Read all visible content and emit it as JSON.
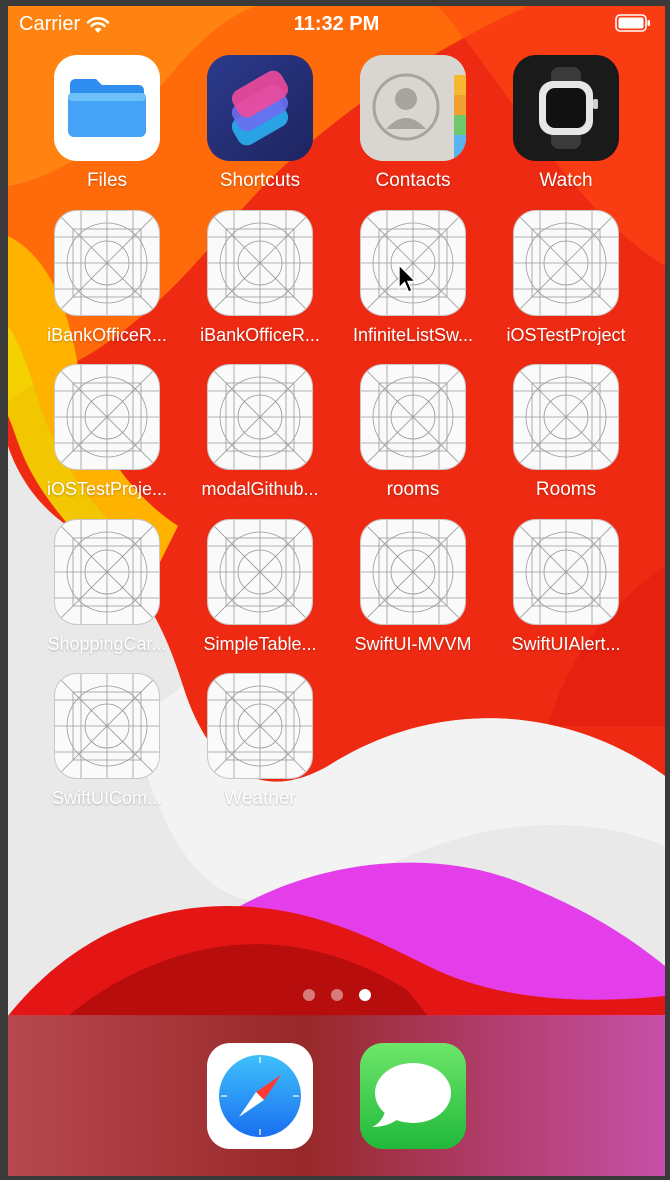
{
  "status_bar": {
    "carrier": "Carrier",
    "time": "11:32 PM",
    "wifi_icon": "wifi-icon",
    "battery_icon": "battery-icon"
  },
  "home_screen": {
    "apps": [
      {
        "label": "Files",
        "icon": "files-folder-icon"
      },
      {
        "label": "Shortcuts",
        "icon": "shortcuts-icon"
      },
      {
        "label": "Contacts",
        "icon": "contacts-icon"
      },
      {
        "label": "Watch",
        "icon": "watch-icon"
      },
      {
        "label": "iBankOfficeR...",
        "icon": "placeholder-app-icon"
      },
      {
        "label": "iBankOfficeR...",
        "icon": "placeholder-app-icon"
      },
      {
        "label": "InfiniteListSw...",
        "icon": "placeholder-app-icon"
      },
      {
        "label": "iOSTestProject",
        "icon": "placeholder-app-icon"
      },
      {
        "label": "iOSTestProje...",
        "icon": "placeholder-app-icon"
      },
      {
        "label": "modalGithub...",
        "icon": "placeholder-app-icon"
      },
      {
        "label": "rooms",
        "icon": "placeholder-app-icon"
      },
      {
        "label": "Rooms",
        "icon": "placeholder-app-icon"
      },
      {
        "label": "ShoppingCar...",
        "icon": "placeholder-app-icon"
      },
      {
        "label": "SimpleTable...",
        "icon": "placeholder-app-icon"
      },
      {
        "label": "SwiftUI-MVVM",
        "icon": "placeholder-app-icon"
      },
      {
        "label": "SwiftUIAlert...",
        "icon": "placeholder-app-icon"
      },
      {
        "label": "SwiftUICom...",
        "icon": "placeholder-app-icon"
      },
      {
        "label": "Weather",
        "icon": "placeholder-app-icon"
      }
    ],
    "page_indicator": {
      "pages": 3,
      "current": 3
    }
  },
  "dock": {
    "apps": [
      {
        "name": "Safari",
        "icon": "safari-compass-icon"
      },
      {
        "name": "Messages",
        "icon": "messages-bubble-icon"
      }
    ]
  },
  "cursor": "mouse-pointer-icon"
}
